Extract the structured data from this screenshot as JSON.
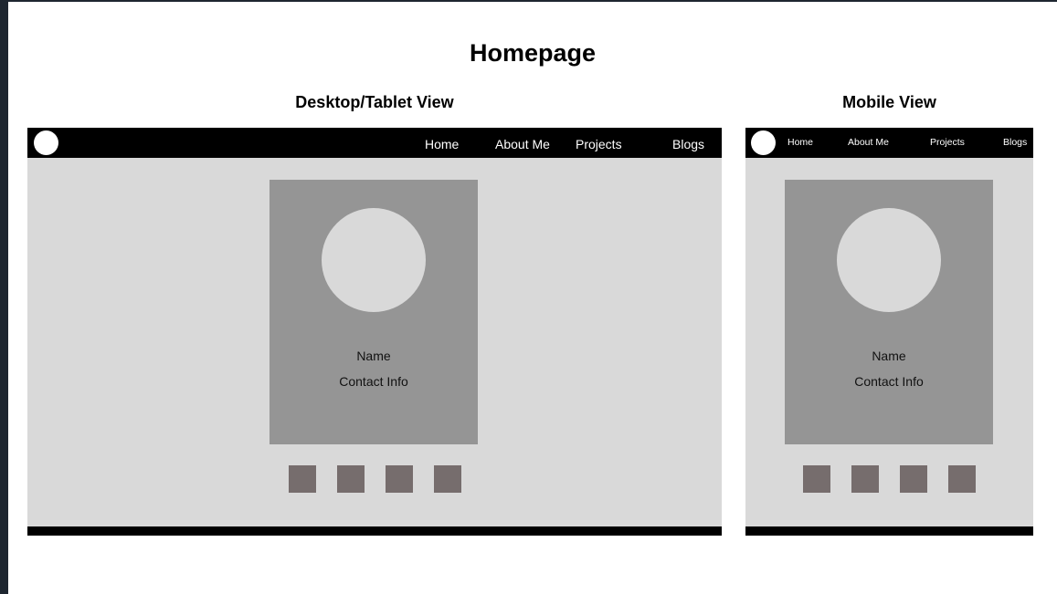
{
  "page": {
    "title": "Homepage"
  },
  "desktop": {
    "title": "Desktop/Tablet View",
    "nav": [
      "Home",
      "About Me",
      "Projects",
      "Blogs"
    ],
    "card": {
      "name": "Name",
      "contact": "Contact Info"
    }
  },
  "mobile": {
    "title": "Mobile View",
    "nav": [
      "Home",
      "About Me",
      "Projects",
      "Blogs"
    ],
    "card": {
      "name": "Name",
      "contact": "Contact Info"
    }
  },
  "colors": {
    "background": "#ffffff",
    "frame": "#d9d9d9",
    "card": "#959595",
    "social_square": "#766d6d",
    "navbar": "#000000"
  }
}
